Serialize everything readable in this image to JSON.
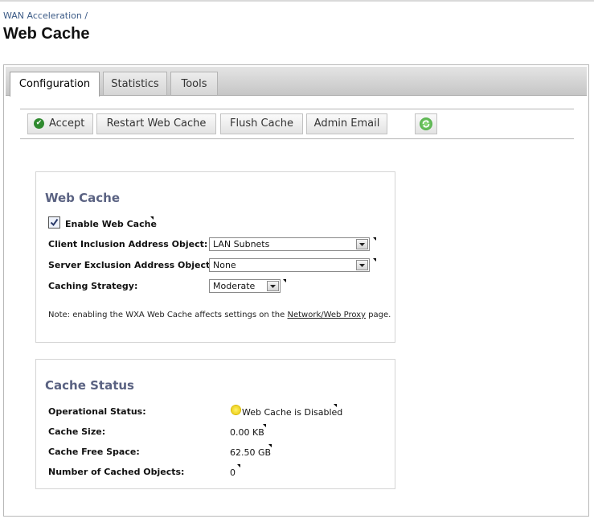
{
  "header": {
    "breadcrumb": "WAN Acceleration /",
    "title": "Web Cache"
  },
  "tabs": [
    {
      "label": "Configuration",
      "active": true
    },
    {
      "label": "Statistics",
      "active": false
    },
    {
      "label": "Tools",
      "active": false
    }
  ],
  "toolbar": {
    "accept_label": "Accept",
    "restart_label": "Restart Web Cache",
    "flush_label": "Flush Cache",
    "admin_label": "Admin Email"
  },
  "web_cache": {
    "title": "Web Cache",
    "enable_label": "Enable Web Cache",
    "enabled": true,
    "client_label": "Client Inclusion Address Object:",
    "client_value": "LAN Subnets",
    "server_label": "Server Exclusion Address Object:",
    "server_value": "None",
    "strategy_label": "Caching Strategy:",
    "strategy_value": "Moderate",
    "note_prefix": "Note: enabling the WXA Web Cache affects settings on the ",
    "note_link": "Network/Web Proxy",
    "note_suffix": " page."
  },
  "cache_status": {
    "title": "Cache Status",
    "operational_label": "Operational Status:",
    "operational_value": "Web Cache is Disabled",
    "size_label": "Cache Size:",
    "size_value": "0.00 KB",
    "free_label": "Cache Free Space:",
    "free_value": "62.50 GB",
    "objects_label": "Number of Cached Objects:",
    "objects_value": "0"
  },
  "colors": {
    "panel_title": "#5a6282",
    "accept_icon": "#2f8a2f",
    "status_icon": "#e8c400"
  }
}
